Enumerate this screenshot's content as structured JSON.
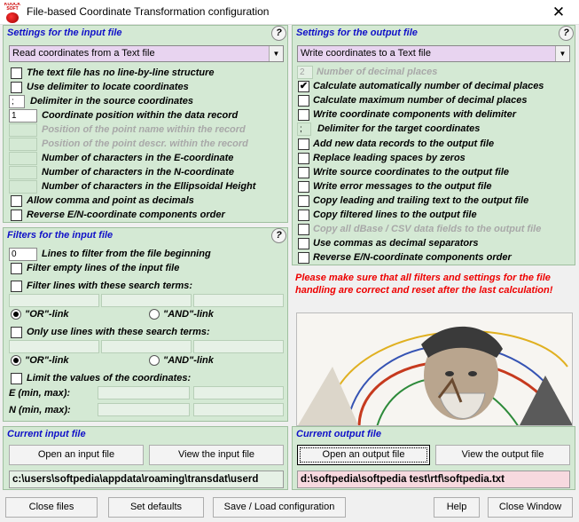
{
  "window": {
    "title": "File-based Coordinate Transformation configuration",
    "logo_text": "KOUCK SOFT"
  },
  "input": {
    "section_title": "Settings for the input file",
    "help": "?",
    "format_select": "Read coordinates from a Text file",
    "options": [
      {
        "label": "The text file has no line-by-line structure",
        "checked": false
      },
      {
        "label": "Use delimiter to locate coordinates",
        "checked": false
      }
    ],
    "delimiter_label": "Delimiter in the source coordinates",
    "delimiter_value": ";",
    "fields": [
      {
        "value": "1",
        "label": "Coordinate position within the data record",
        "disabled": false
      },
      {
        "value": "",
        "label": "Position of the point name within the record",
        "disabled": true
      },
      {
        "value": "",
        "label": "Position of the point descr. within the record",
        "disabled": true
      },
      {
        "value": "",
        "label": "Number of characters in the E-coordinate",
        "disabled": false
      },
      {
        "value": "",
        "label": "Number of characters in the N-coordinate",
        "disabled": false
      },
      {
        "value": "",
        "label": "Number of characters in the Ellipsoidal Height",
        "disabled": false
      }
    ],
    "options2": [
      {
        "label": "Allow comma and point as decimals",
        "checked": false
      },
      {
        "label": "Reverse E/N-coordinate components order",
        "checked": false
      }
    ]
  },
  "filters": {
    "section_title": "Filters for the input file",
    "help": "?",
    "lines_value": "0",
    "lines_label": "Lines to filter from the file beginning",
    "filter_empty": "Filter empty lines of the input file",
    "filter_terms": "Filter lines with these search terms:",
    "or_link": "\"OR\"-link",
    "and_link": "\"AND\"-link",
    "only_terms": "Only use lines with these search terms:",
    "limit_label": "Limit the values of the coordinates:",
    "e_label": "E (min, max):",
    "n_label": "N (min, max):"
  },
  "output": {
    "section_title": "Settings for the output file",
    "help": "?",
    "format_select": "Write coordinates to a Text file",
    "decimal_value": "2",
    "decimal_label": "Number of decimal places",
    "options_a": [
      {
        "label": "Calculate automatically number of decimal places",
        "checked": true,
        "disabled": false
      },
      {
        "label": "Calculate maximum number of decimal places",
        "checked": false,
        "disabled": false
      },
      {
        "label": "Write coordinate components with delimiter",
        "checked": false,
        "disabled": false
      }
    ],
    "delimiter_value": ";",
    "delimiter_label": "Delimiter for the target coordinates",
    "options_b": [
      {
        "label": "Add new data records to the output file",
        "checked": false,
        "disabled": false
      },
      {
        "label": "Replace leading spaces by zeros",
        "checked": false,
        "disabled": false
      },
      {
        "label": "Write source coordinates to the output file",
        "checked": false,
        "disabled": false
      },
      {
        "label": "Write error messages to the output file",
        "checked": false,
        "disabled": false
      },
      {
        "label": "Copy leading and trailing text to the output file",
        "checked": false,
        "disabled": false
      },
      {
        "label": "Copy filtered lines to the output file",
        "checked": false,
        "disabled": false
      },
      {
        "label": "Copy all dBase / CSV data fields to the output file",
        "checked": false,
        "disabled": true
      },
      {
        "label": "Use commas as decimal separators",
        "checked": false,
        "disabled": false
      },
      {
        "label": "Reverse E/N-coordinate components order",
        "checked": false,
        "disabled": false
      }
    ],
    "warning": "Please make sure that all filters and settings for the file handling are correct and reset after the last calculation!"
  },
  "current_input": {
    "title": "Current input file",
    "open_btn": "Open an input file",
    "view_btn": "View the input file",
    "path": "c:\\users\\softpedia\\appdata\\roaming\\transdat\\userd"
  },
  "current_output": {
    "title": "Current output file",
    "open_btn": "Open an output file",
    "view_btn": "View the output file",
    "path": "d:\\softpedia\\softpedia test\\rtf\\softpedia.txt"
  },
  "bottom": {
    "close_files": "Close files",
    "set_defaults": "Set defaults",
    "save_load": "Save / Load configuration",
    "help": "Help",
    "close_window": "Close Window"
  },
  "icons": {
    "close": "close-icon",
    "dropdown": "chevron-down-icon",
    "help": "help-icon",
    "check": "✔"
  },
  "colors": {
    "panel": "#d4e9d4",
    "title": "#1010c8",
    "warning": "#e00000",
    "select": "#e8d4f0"
  }
}
